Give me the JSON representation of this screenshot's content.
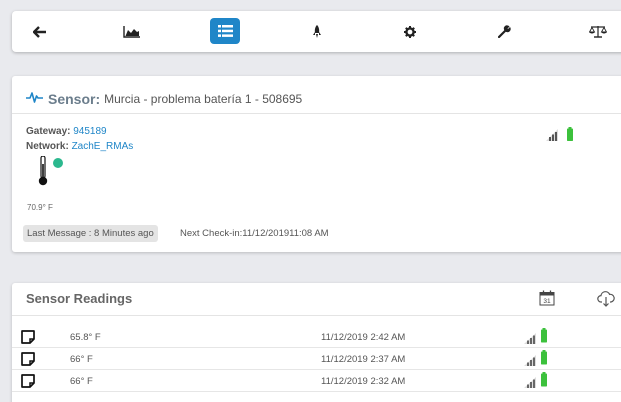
{
  "toolbar": {
    "items": [
      {
        "icon": "back-arrow-icon"
      },
      {
        "icon": "chart-icon"
      },
      {
        "icon": "list-icon",
        "active": true
      },
      {
        "icon": "rocket-icon"
      },
      {
        "icon": "gear-icon"
      },
      {
        "icon": "wrench-icon"
      },
      {
        "icon": "scale-icon"
      }
    ],
    "active_color": "#1f86c8"
  },
  "sensor": {
    "label": "Sensor:",
    "name": "Murcia - problema batería 1 - 508695",
    "gateway_label": "Gateway:",
    "gateway_value": "945189",
    "network_label": "Network:",
    "network_value": "ZachE_RMAs",
    "temperature": "70.9° F",
    "last_message": "Last Message : 8 Minutes ago",
    "next_checkin": "Next Check-in:11/12/201911:08 AM",
    "status_color": "#2bb88e",
    "battery_color": "#3cc13c"
  },
  "readings": {
    "title": "Sensor Readings",
    "calendar_day": "31",
    "rows": [
      {
        "temp": "65.8° F",
        "date": "11/12/2019 2:42 AM"
      },
      {
        "temp": "66° F",
        "date": "11/12/2019 2:37 AM"
      },
      {
        "temp": "66° F",
        "date": "11/12/2019 2:32 AM"
      }
    ]
  }
}
